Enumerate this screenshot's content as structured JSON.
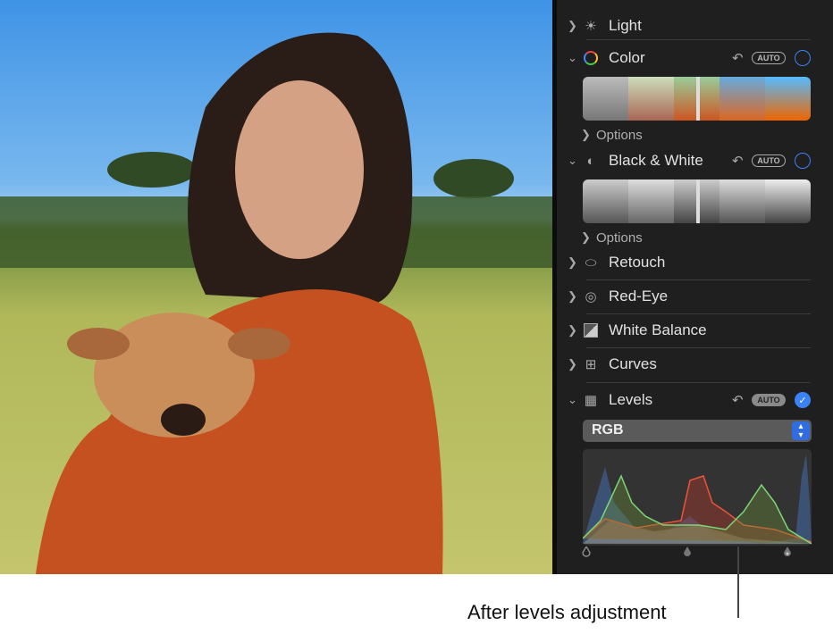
{
  "panel": {
    "sections": [
      {
        "label": "Light",
        "icon": "sun-icon",
        "expanded": false
      },
      {
        "label": "Color",
        "icon": "color-wheel-icon",
        "expanded": true,
        "auto": "AUTO",
        "enabled": false,
        "options": "Options"
      },
      {
        "label": "Black & White",
        "icon": "half-circle-icon",
        "expanded": true,
        "auto": "AUTO",
        "enabled": false,
        "options": "Options"
      },
      {
        "label": "Retouch",
        "icon": "bandage-icon",
        "expanded": false
      },
      {
        "label": "Red-Eye",
        "icon": "eye-slash-icon",
        "expanded": false
      },
      {
        "label": "White Balance",
        "icon": "white-balance-icon",
        "expanded": false
      },
      {
        "label": "Curves",
        "icon": "curves-icon",
        "expanded": false
      },
      {
        "label": "Levels",
        "icon": "levels-icon",
        "expanded": true,
        "auto": "AUTO",
        "enabled": true
      }
    ],
    "levels_channel": "RGB"
  },
  "caption": "After levels adjustment",
  "colors": {
    "accent": "#3b82f6",
    "panel_bg": "#1f1f1f"
  }
}
